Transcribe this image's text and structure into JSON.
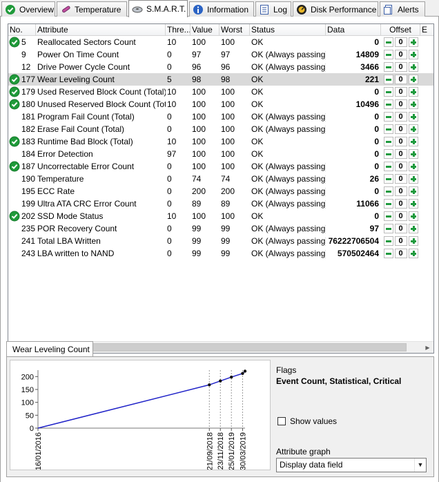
{
  "tabs": [
    {
      "label": "Overview",
      "icon": "check-circle-icon"
    },
    {
      "label": "Temperature",
      "icon": "thermometer-icon"
    },
    {
      "label": "S.M.A.R.T.",
      "icon": "disk-icon"
    },
    {
      "label": "Information",
      "icon": "info-icon"
    },
    {
      "label": "Log",
      "icon": "log-icon"
    },
    {
      "label": "Disk Performance",
      "icon": "gauge-icon"
    },
    {
      "label": "Alerts",
      "icon": "alert-icon"
    }
  ],
  "columns": [
    "No.",
    "Attribute",
    "Thre...",
    "Value",
    "Worst",
    "Status",
    "Data",
    "Offset",
    "E"
  ],
  "rows": [
    {
      "check": true,
      "no": "5",
      "attr": "Reallocated Sectors Count",
      "thr": "10",
      "val": "100",
      "worst": "100",
      "status": "OK",
      "data": "0",
      "offset": "0"
    },
    {
      "check": false,
      "no": "9",
      "attr": "Power On Time Count",
      "thr": "0",
      "val": "97",
      "worst": "97",
      "status": "OK (Always passing)",
      "data": "14809",
      "offset": "0"
    },
    {
      "check": false,
      "no": "12",
      "attr": "Drive Power Cycle Count",
      "thr": "0",
      "val": "96",
      "worst": "96",
      "status": "OK (Always passing)",
      "data": "3466",
      "offset": "0"
    },
    {
      "check": true,
      "no": "177",
      "attr": "Wear Leveling Count",
      "thr": "5",
      "val": "98",
      "worst": "98",
      "status": "OK",
      "data": "221",
      "offset": "0",
      "selected": true
    },
    {
      "check": true,
      "no": "179",
      "attr": "Used Reserved Block Count (Total)",
      "thr": "10",
      "val": "100",
      "worst": "100",
      "status": "OK",
      "data": "0",
      "offset": "0"
    },
    {
      "check": true,
      "no": "180",
      "attr": "Unused Reserved Block Count (Tot...",
      "thr": "10",
      "val": "100",
      "worst": "100",
      "status": "OK",
      "data": "10496",
      "offset": "0"
    },
    {
      "check": false,
      "no": "181",
      "attr": "Program Fail Count (Total)",
      "thr": "0",
      "val": "100",
      "worst": "100",
      "status": "OK (Always passing)",
      "data": "0",
      "offset": "0"
    },
    {
      "check": false,
      "no": "182",
      "attr": "Erase Fail Count (Total)",
      "thr": "0",
      "val": "100",
      "worst": "100",
      "status": "OK (Always passing)",
      "data": "0",
      "offset": "0"
    },
    {
      "check": true,
      "no": "183",
      "attr": "Runtime Bad Block (Total)",
      "thr": "10",
      "val": "100",
      "worst": "100",
      "status": "OK",
      "data": "0",
      "offset": "0"
    },
    {
      "check": false,
      "no": "184",
      "attr": "Error Detection",
      "thr": "97",
      "val": "100",
      "worst": "100",
      "status": "OK",
      "data": "0",
      "offset": "0"
    },
    {
      "check": true,
      "no": "187",
      "attr": "Uncorrectable Error Count",
      "thr": "0",
      "val": "100",
      "worst": "100",
      "status": "OK (Always passing)",
      "data": "0",
      "offset": "0"
    },
    {
      "check": false,
      "no": "190",
      "attr": "Temperature",
      "thr": "0",
      "val": "74",
      "worst": "74",
      "status": "OK (Always passing)",
      "data": "26",
      "offset": "0"
    },
    {
      "check": false,
      "no": "195",
      "attr": "ECC Rate",
      "thr": "0",
      "val": "200",
      "worst": "200",
      "status": "OK (Always passing)",
      "data": "0",
      "offset": "0"
    },
    {
      "check": false,
      "no": "199",
      "attr": "Ultra ATA CRC Error Count",
      "thr": "0",
      "val": "89",
      "worst": "89",
      "status": "OK (Always passing)",
      "data": "11066",
      "offset": "0"
    },
    {
      "check": true,
      "no": "202",
      "attr": "SSD Mode Status",
      "thr": "10",
      "val": "100",
      "worst": "100",
      "status": "OK",
      "data": "0",
      "offset": "0"
    },
    {
      "check": false,
      "no": "235",
      "attr": "POR Recovery Count",
      "thr": "0",
      "val": "99",
      "worst": "99",
      "status": "OK (Always passing)",
      "data": "97",
      "offset": "0"
    },
    {
      "check": false,
      "no": "241",
      "attr": "Total LBA Written",
      "thr": "0",
      "val": "99",
      "worst": "99",
      "status": "OK (Always passing)",
      "data": "76222706504",
      "offset": "0"
    },
    {
      "check": false,
      "no": "243",
      "attr": "LBA written to NAND",
      "thr": "0",
      "val": "99",
      "worst": "99",
      "status": "OK (Always passing)",
      "data": "570502464",
      "offset": "0"
    }
  ],
  "detail": {
    "tab_label": "Wear Leveling Count",
    "flags_label": "Flags",
    "flags_value": "Event Count, Statistical, Critical",
    "show_values_label": "Show values",
    "show_values_checked": false,
    "attribute_graph_label": "Attribute graph",
    "attribute_graph_value": "Display data field"
  },
  "chart_data": {
    "type": "line",
    "title": "",
    "xlabel": "",
    "ylabel": "",
    "ylim": [
      0,
      225
    ],
    "yticks": [
      0,
      50,
      100,
      150,
      200
    ],
    "xticks": [
      "16/01/2016",
      "21/09/2018",
      "23/11/2018",
      "25/01/2019",
      "30/03/2019"
    ],
    "series_color": "#1f22c8",
    "series": [
      {
        "x": [
          "16/01/2016",
          "21/09/2018",
          "23/11/2018",
          "25/01/2019",
          "30/03/2019",
          "13/04/2019"
        ],
        "values": [
          0,
          168,
          183,
          198,
          212,
          221
        ]
      }
    ]
  }
}
